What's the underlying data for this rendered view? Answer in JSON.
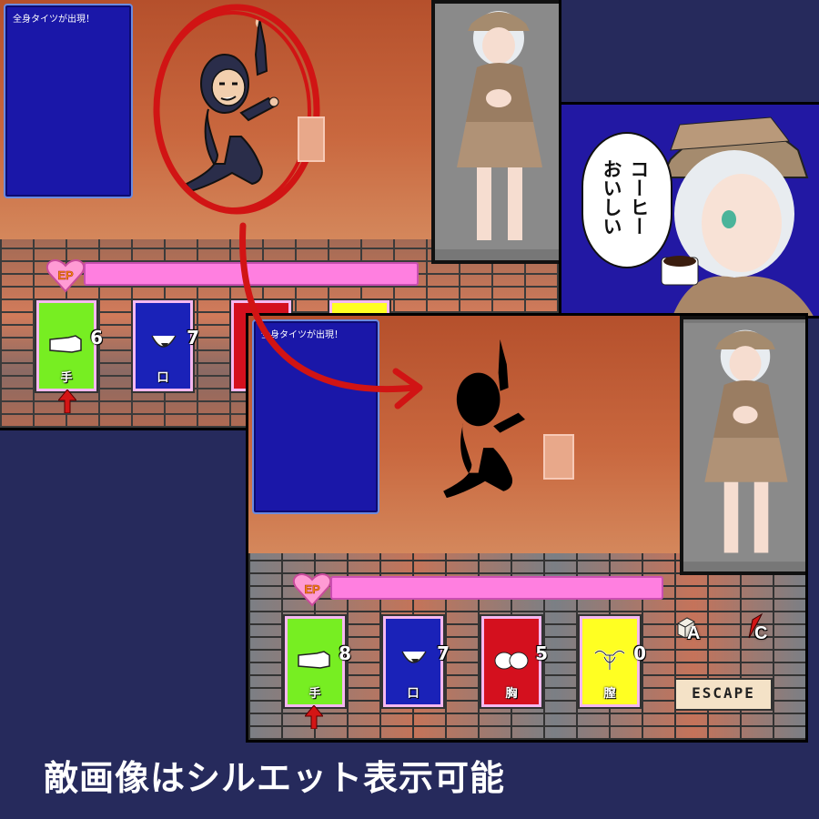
{
  "top_screen": {
    "message": "全身タイツが出現！",
    "cards": [
      {
        "label": "手",
        "value": "6",
        "color": "#77ee22",
        "icon": "hand-icon",
        "selected": true
      },
      {
        "label": "口",
        "value": "7",
        "color": "#1a22b8",
        "icon": "mouth-icon",
        "selected": false
      }
    ]
  },
  "bottom_screen": {
    "message": "全身タイツが出現！",
    "cards": [
      {
        "label": "手",
        "value": "8",
        "color": "#77ee22",
        "icon": "hand-icon",
        "selected": true
      },
      {
        "label": "口",
        "value": "7",
        "color": "#1a22b8",
        "icon": "mouth-icon",
        "selected": false
      },
      {
        "label": "胸",
        "value": "5",
        "color": "#d4101e",
        "icon": "chest-icon",
        "selected": false
      },
      {
        "label": "膣",
        "value": "0",
        "color": "#ffff22",
        "icon": "uterus-icon",
        "selected": false
      }
    ],
    "keys": {
      "a": "A",
      "c": "C"
    },
    "escape_label": "ESCAPE"
  },
  "ep_label": "EP",
  "speech_bubble": {
    "line1": "コーヒー",
    "line2": "おいしい"
  },
  "caption": "敵画像はシルエット表示可能",
  "colors": {
    "background": "#262a5c",
    "ep_bar": "#ff7fe0",
    "highlight_circle": "#d11414"
  }
}
